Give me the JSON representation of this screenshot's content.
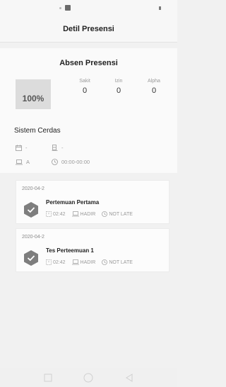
{
  "header": {
    "title": "Detil Presensi"
  },
  "summary": {
    "title": "Absen Presensi",
    "percent": "100%",
    "stats": [
      {
        "label": "Sakit",
        "value": "0"
      },
      {
        "label": "Izin",
        "value": "0"
      },
      {
        "label": "Alpha",
        "value": "0"
      }
    ]
  },
  "sistem": {
    "title": "Sistem Cerdas",
    "date_value": "-",
    "room_value": "-",
    "class_value": "A",
    "time_value": "00:00-00:00"
  },
  "meetings": [
    {
      "date": "2020-04-2",
      "title": "Pertemuan Pertama",
      "duration": "02:42",
      "status": "HADIR",
      "late": "NOT LATE"
    },
    {
      "date": "2020-04-2",
      "title": "Tes Perteemuan 1",
      "duration": "02:42",
      "status": "HADIR",
      "late": "NOT LATE"
    }
  ],
  "colors": {
    "accent": "#777777",
    "background": "#f1f1f1"
  }
}
